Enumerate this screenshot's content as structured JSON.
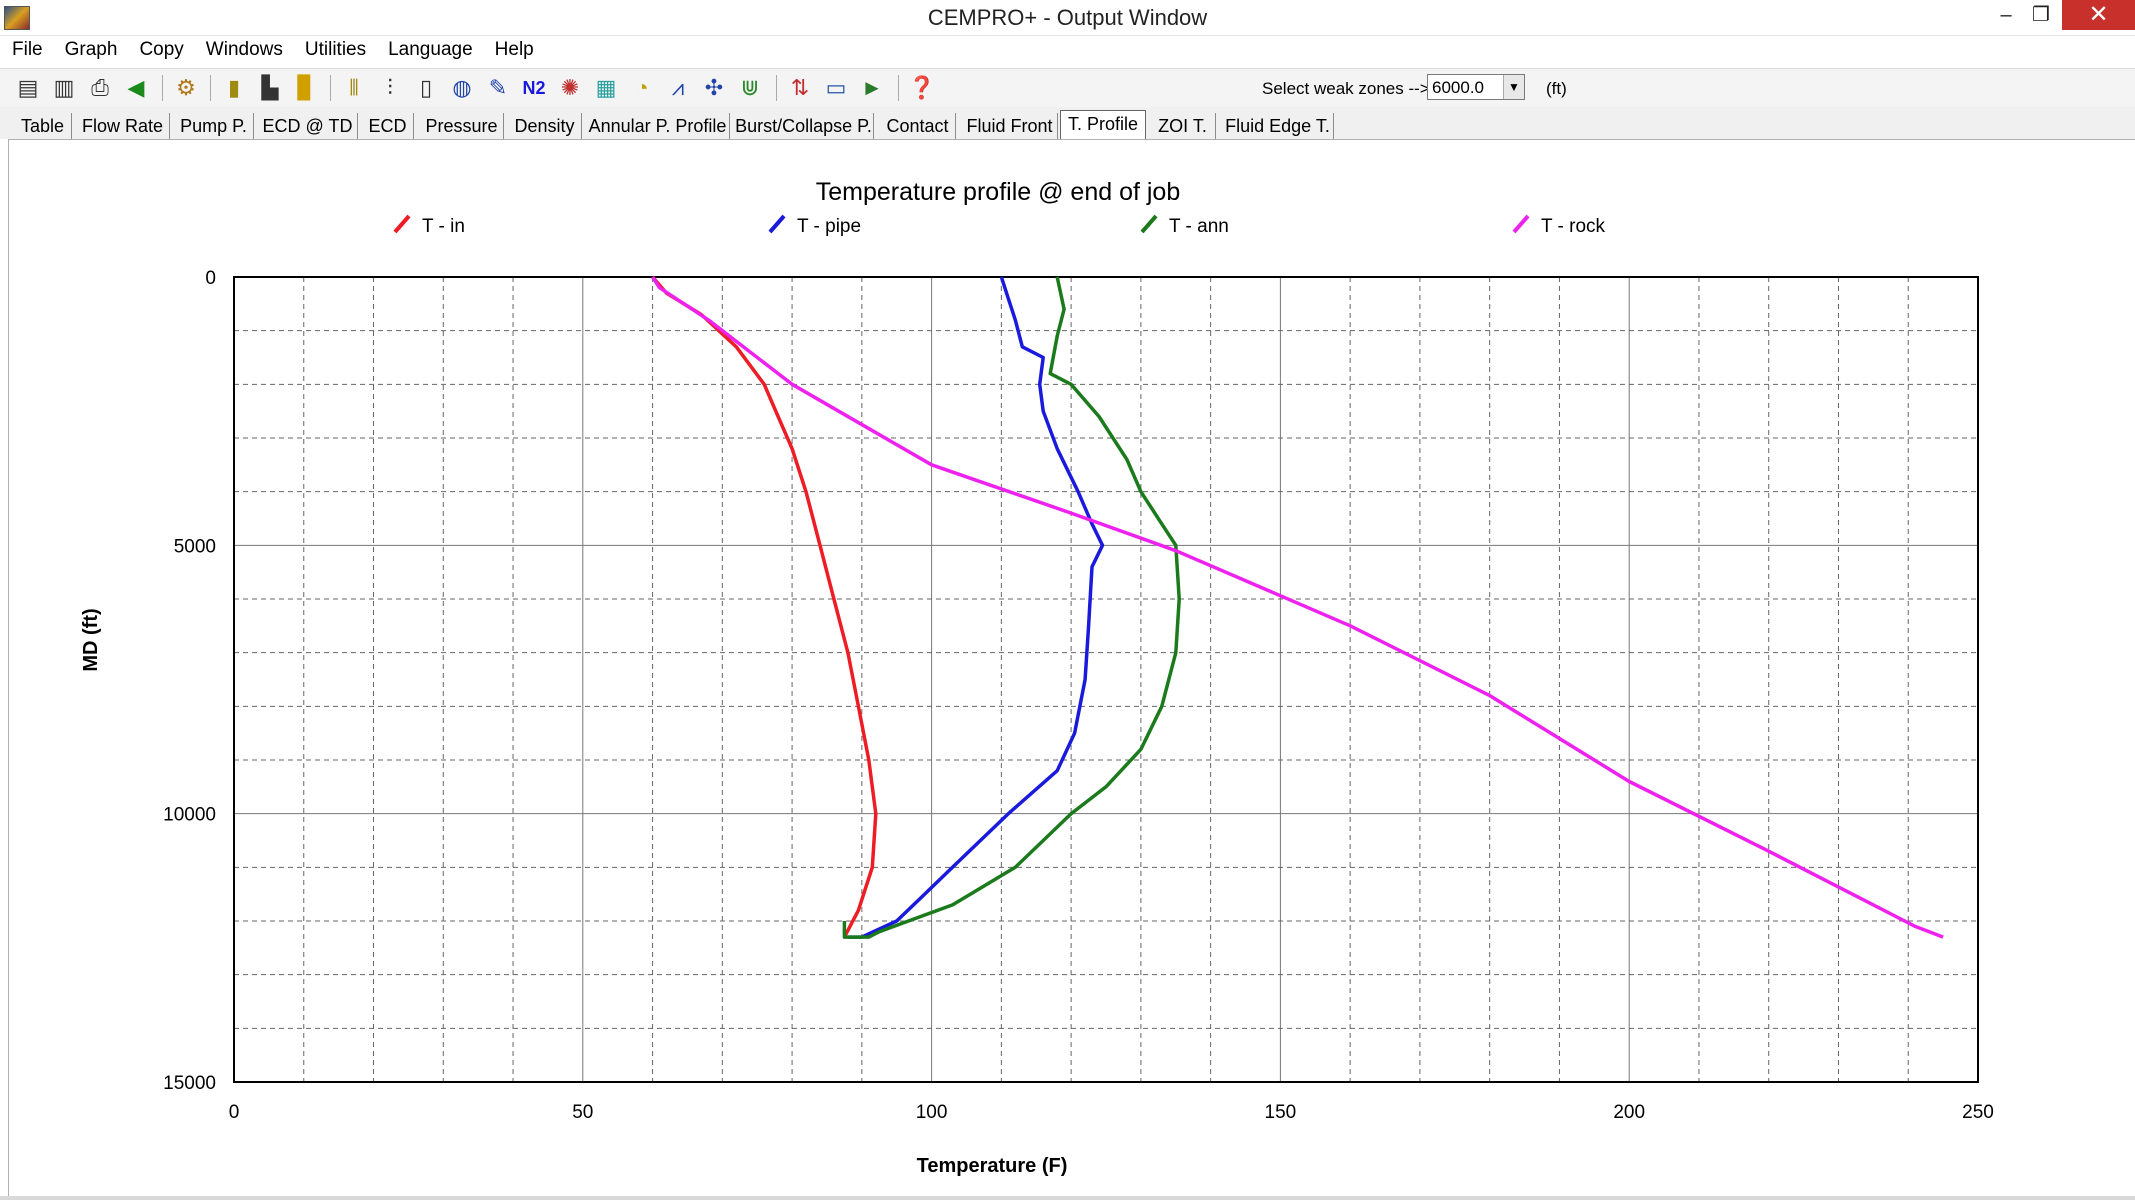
{
  "window": {
    "title": "CEMPRO+ - Output Window",
    "min": "–",
    "restore": "❐",
    "close": "✕"
  },
  "menu": [
    "File",
    "Graph",
    "Copy",
    "Windows",
    "Utilities",
    "Language",
    "Help"
  ],
  "toolbar": {
    "icons": [
      "save-icon",
      "save-as-icon",
      "print-icon",
      "back-icon",
      "pump-icon",
      "bar-chart-icon",
      "shoe-icon",
      "color-scale-icon",
      "well-schematic-icon",
      "well-schematic-2-icon",
      "casing-icon",
      "globe-icon",
      "graph-edit-icon",
      "nitrogen-icon",
      "network-icon",
      "map-icon",
      "gauge-icon",
      "chart-icon",
      "tools-icon",
      "magnet-icon",
      "sort-icon",
      "monitor-icon",
      "truck-icon",
      "help-icon"
    ],
    "n2_label": "N2",
    "weak_zone_label": "Select weak zones -->",
    "weak_zone_value": "6000.0",
    "weak_zone_unit": "(ft)"
  },
  "tabs": [
    "Table",
    "Flow Rate",
    "Pump P.",
    "ECD @ TD",
    "ECD",
    "Pressure",
    "Density",
    "Annular P. Profile",
    "Burst/Collapse P.",
    "Contact",
    "Fluid Front",
    "T. Profile",
    "ZOI T.",
    "Fluid Edge T."
  ],
  "active_tab": "T. Profile",
  "colors": {
    "t_in": "#ee1c24",
    "t_pipe": "#1a1adc",
    "t_ann": "#1b7a1b",
    "t_rock": "#ee22ee"
  },
  "chart_data": {
    "type": "line",
    "title": "Temperature profile @ end of job",
    "xlabel": "Temperature (F)",
    "ylabel": "MD (ft)",
    "xlim": [
      0,
      250
    ],
    "ylim": [
      0,
      15000
    ],
    "y_inverted": true,
    "x_ticks": [
      "0",
      "50",
      "100",
      "150",
      "200",
      "250"
    ],
    "y_ticks": [
      "0",
      "5000",
      "10000",
      "15000"
    ],
    "grid": true,
    "legend": "top",
    "series": [
      {
        "name": "T - in",
        "color": "#ee1c24",
        "points": [
          [
            60,
            0
          ],
          [
            62,
            300
          ],
          [
            67,
            700
          ],
          [
            72,
            1300
          ],
          [
            76,
            2000
          ],
          [
            78,
            2600
          ],
          [
            80,
            3200
          ],
          [
            82,
            4000
          ],
          [
            84,
            5000
          ],
          [
            86,
            6000
          ],
          [
            88,
            7000
          ],
          [
            89.5,
            8000
          ],
          [
            91,
            9000
          ],
          [
            92,
            10000
          ],
          [
            91.5,
            11000
          ],
          [
            89.5,
            11800
          ],
          [
            87.5,
            12300
          ]
        ]
      },
      {
        "name": "T - pipe",
        "color": "#1a1adc",
        "points": [
          [
            110,
            0
          ],
          [
            111,
            400
          ],
          [
            112,
            800
          ],
          [
            113,
            1300
          ],
          [
            116,
            1500
          ],
          [
            115.5,
            2000
          ],
          [
            116,
            2500
          ],
          [
            118,
            3200
          ],
          [
            121,
            4000
          ],
          [
            123,
            4600
          ],
          [
            124.5,
            5000
          ],
          [
            123,
            5400
          ],
          [
            122.5,
            6500
          ],
          [
            122,
            7500
          ],
          [
            120.5,
            8500
          ],
          [
            118,
            9200
          ],
          [
            111,
            10000
          ],
          [
            103,
            11000
          ],
          [
            99,
            11500
          ],
          [
            95,
            12000
          ],
          [
            90,
            12300
          ],
          [
            88,
            12300
          ]
        ]
      },
      {
        "name": "T - ann",
        "color": "#1b7a1b",
        "points": [
          [
            118,
            0
          ],
          [
            119,
            600
          ],
          [
            118,
            1100
          ],
          [
            117,
            1800
          ],
          [
            120,
            2000
          ],
          [
            124,
            2600
          ],
          [
            128,
            3400
          ],
          [
            130,
            4000
          ],
          [
            133,
            4600
          ],
          [
            135,
            5000
          ],
          [
            135.5,
            6000
          ],
          [
            135,
            7000
          ],
          [
            133,
            8000
          ],
          [
            130,
            8800
          ],
          [
            125,
            9500
          ],
          [
            120,
            10000
          ],
          [
            112,
            11000
          ],
          [
            103,
            11700
          ],
          [
            92.5,
            12200
          ],
          [
            91,
            12300
          ],
          [
            87.5,
            12300
          ],
          [
            87.5,
            12000
          ]
        ]
      },
      {
        "name": "T - rock",
        "color": "#ee22ee",
        "points": [
          [
            60,
            0
          ],
          [
            61,
            200
          ],
          [
            68,
            800
          ],
          [
            80,
            2000
          ],
          [
            100,
            3500
          ],
          [
            120,
            4400
          ],
          [
            135,
            5100
          ],
          [
            160,
            6500
          ],
          [
            180,
            7800
          ],
          [
            200,
            9400
          ],
          [
            220,
            10700
          ],
          [
            241,
            12100
          ],
          [
            243,
            12200
          ],
          [
            245,
            12300
          ]
        ]
      }
    ]
  }
}
